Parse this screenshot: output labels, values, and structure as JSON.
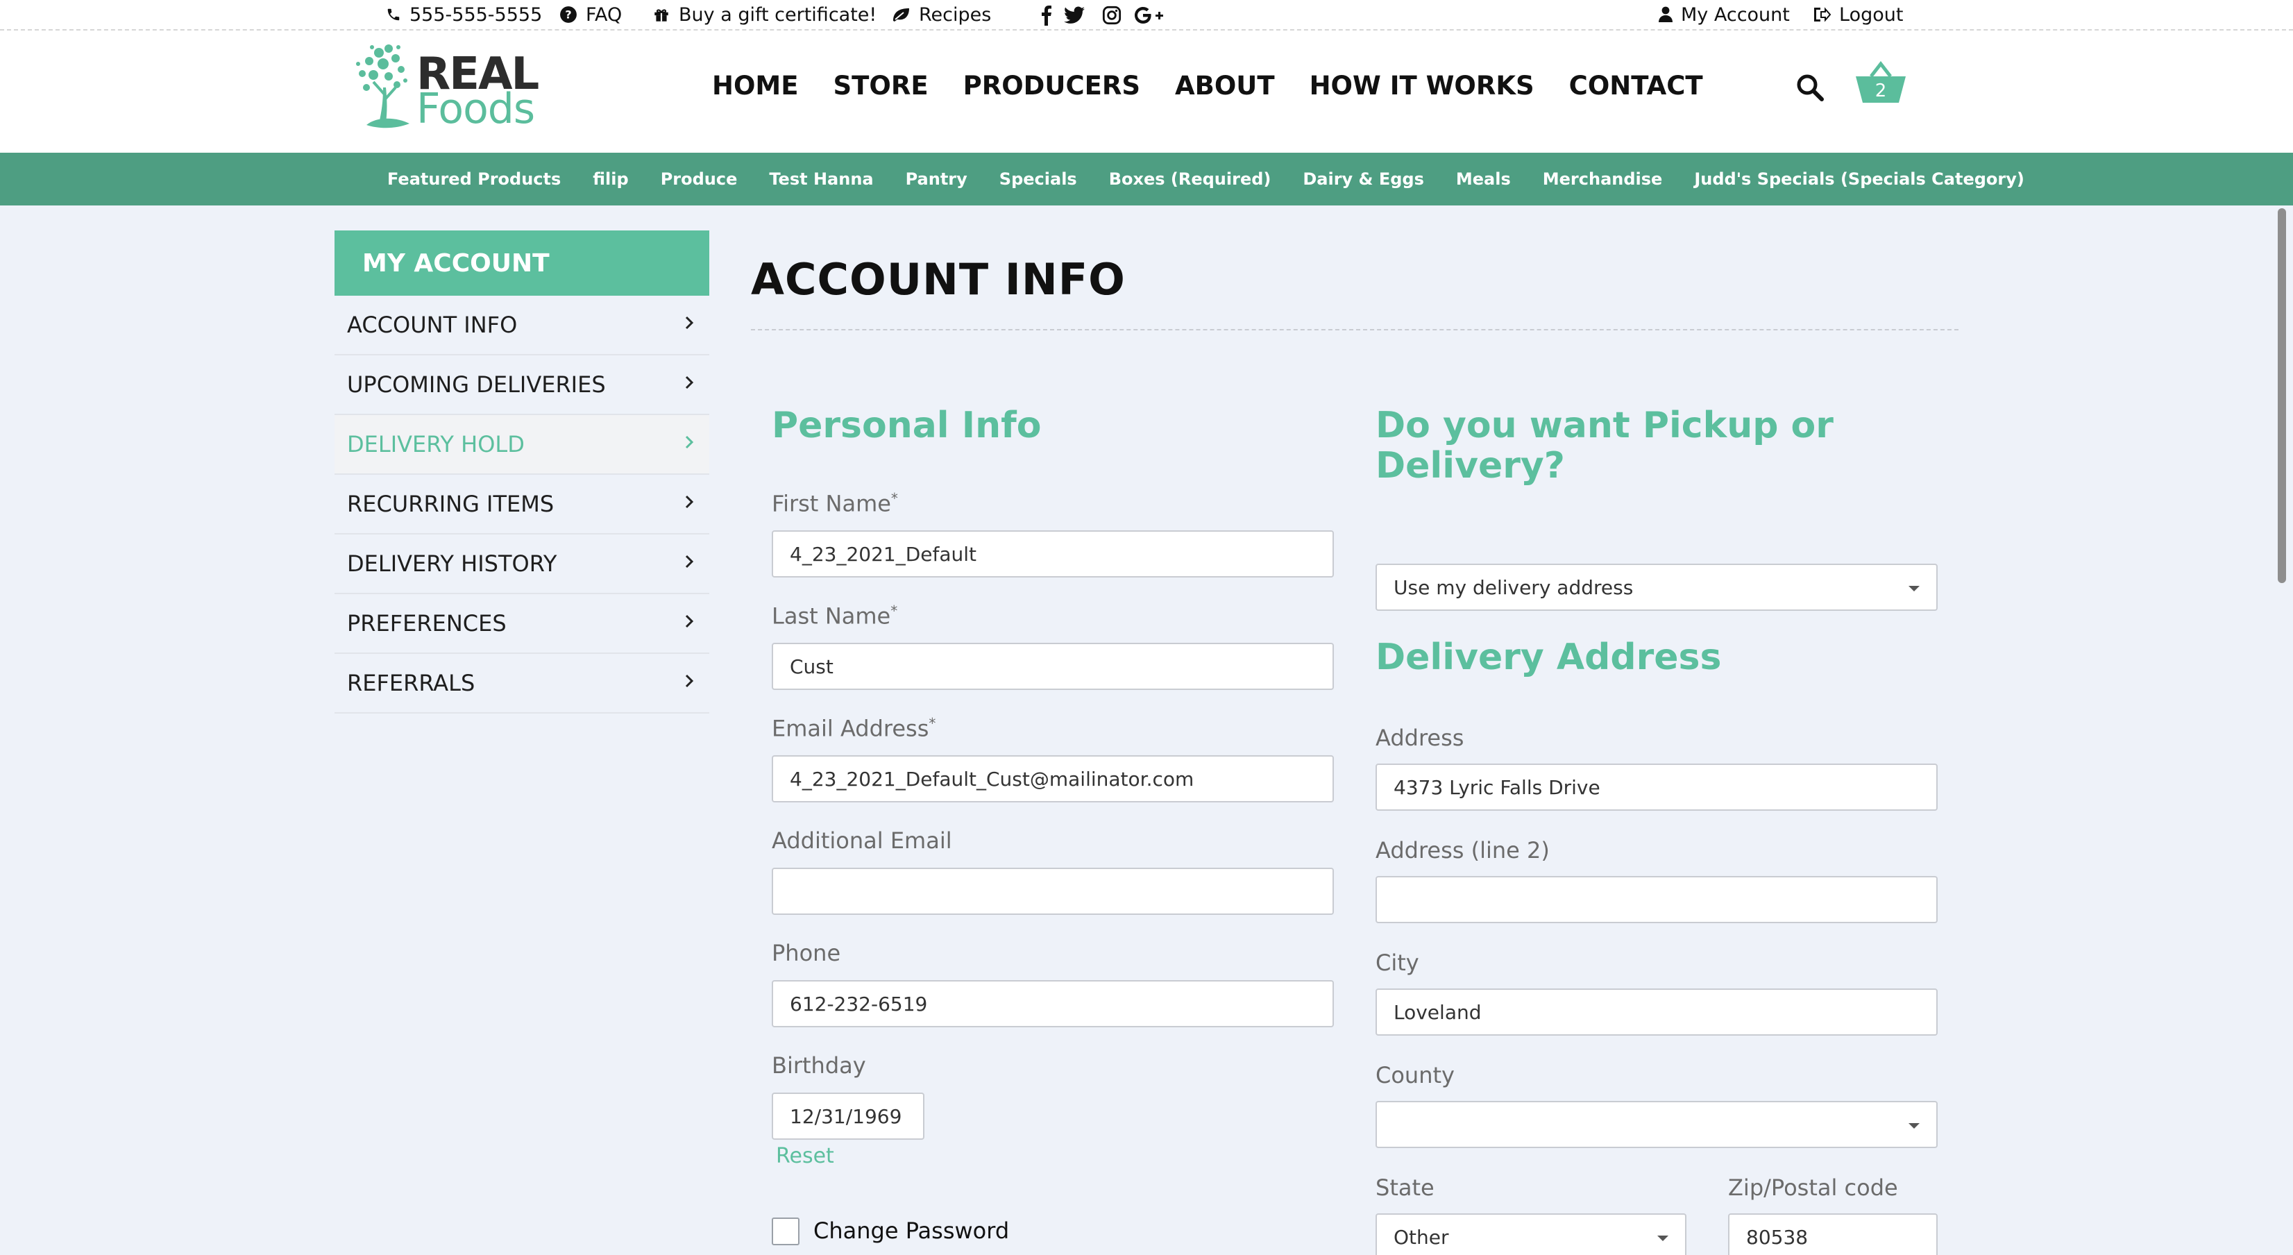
{
  "topbar": {
    "phone": "555-555-5555",
    "faq": "FAQ",
    "gift": "Buy a gift certificate!",
    "recipes": "Recipes",
    "my_account": "My Account",
    "logout": "Logout"
  },
  "logo": {
    "line1": "REAL",
    "line2": "Foods"
  },
  "mainnav": [
    "HOME",
    "STORE",
    "PRODUCERS",
    "ABOUT",
    "HOW IT WORKS",
    "CONTACT"
  ],
  "cart": {
    "count": "2"
  },
  "categories": [
    "Featured Products",
    "filip",
    "Produce",
    "Test Hanna",
    "Pantry",
    "Specials",
    "Boxes (Required)",
    "Dairy & Eggs",
    "Meals",
    "Merchandise",
    "Judd's Specials (Specials Category)"
  ],
  "sidebar": {
    "title": "MY ACCOUNT",
    "items": [
      "ACCOUNT INFO",
      "UPCOMING DELIVERIES",
      "DELIVERY HOLD",
      "RECURRING ITEMS",
      "DELIVERY HISTORY",
      "PREFERENCES",
      "REFERRALS"
    ],
    "active_index": 2
  },
  "page_title": "ACCOUNT INFO",
  "personal": {
    "heading": "Personal Info",
    "first_name_label": "First Name",
    "first_name": "4_23_2021_Default",
    "last_name_label": "Last Name",
    "last_name": "Cust",
    "email_label": "Email Address",
    "email": "4_23_2021_Default_Cust@mailinator.com",
    "add_email_label": "Additional Email",
    "add_email": "",
    "phone_label": "Phone",
    "phone": "612-232-6519",
    "birthday_label": "Birthday",
    "birthday": "12/31/1969",
    "reset": "Reset",
    "change_password": "Change Password",
    "required_mark": "*"
  },
  "pickup": {
    "heading_line1": "Do you want Pickup or",
    "heading_line2": "Delivery?",
    "selected": "Use my delivery address"
  },
  "delivery": {
    "heading": "Delivery Address",
    "address_label": "Address",
    "address": "4373 Lyric Falls Drive",
    "address2_label": "Address (line 2)",
    "address2": "",
    "city_label": "City",
    "city": "Loveland",
    "county_label": "County",
    "county": "",
    "state_label": "State",
    "state": "Other",
    "zip_label": "Zip/Postal code",
    "zip": "80538"
  },
  "colors": {
    "accent": "#5cbf9e",
    "catbar": "#4e9e82",
    "background": "#eef2f9"
  }
}
